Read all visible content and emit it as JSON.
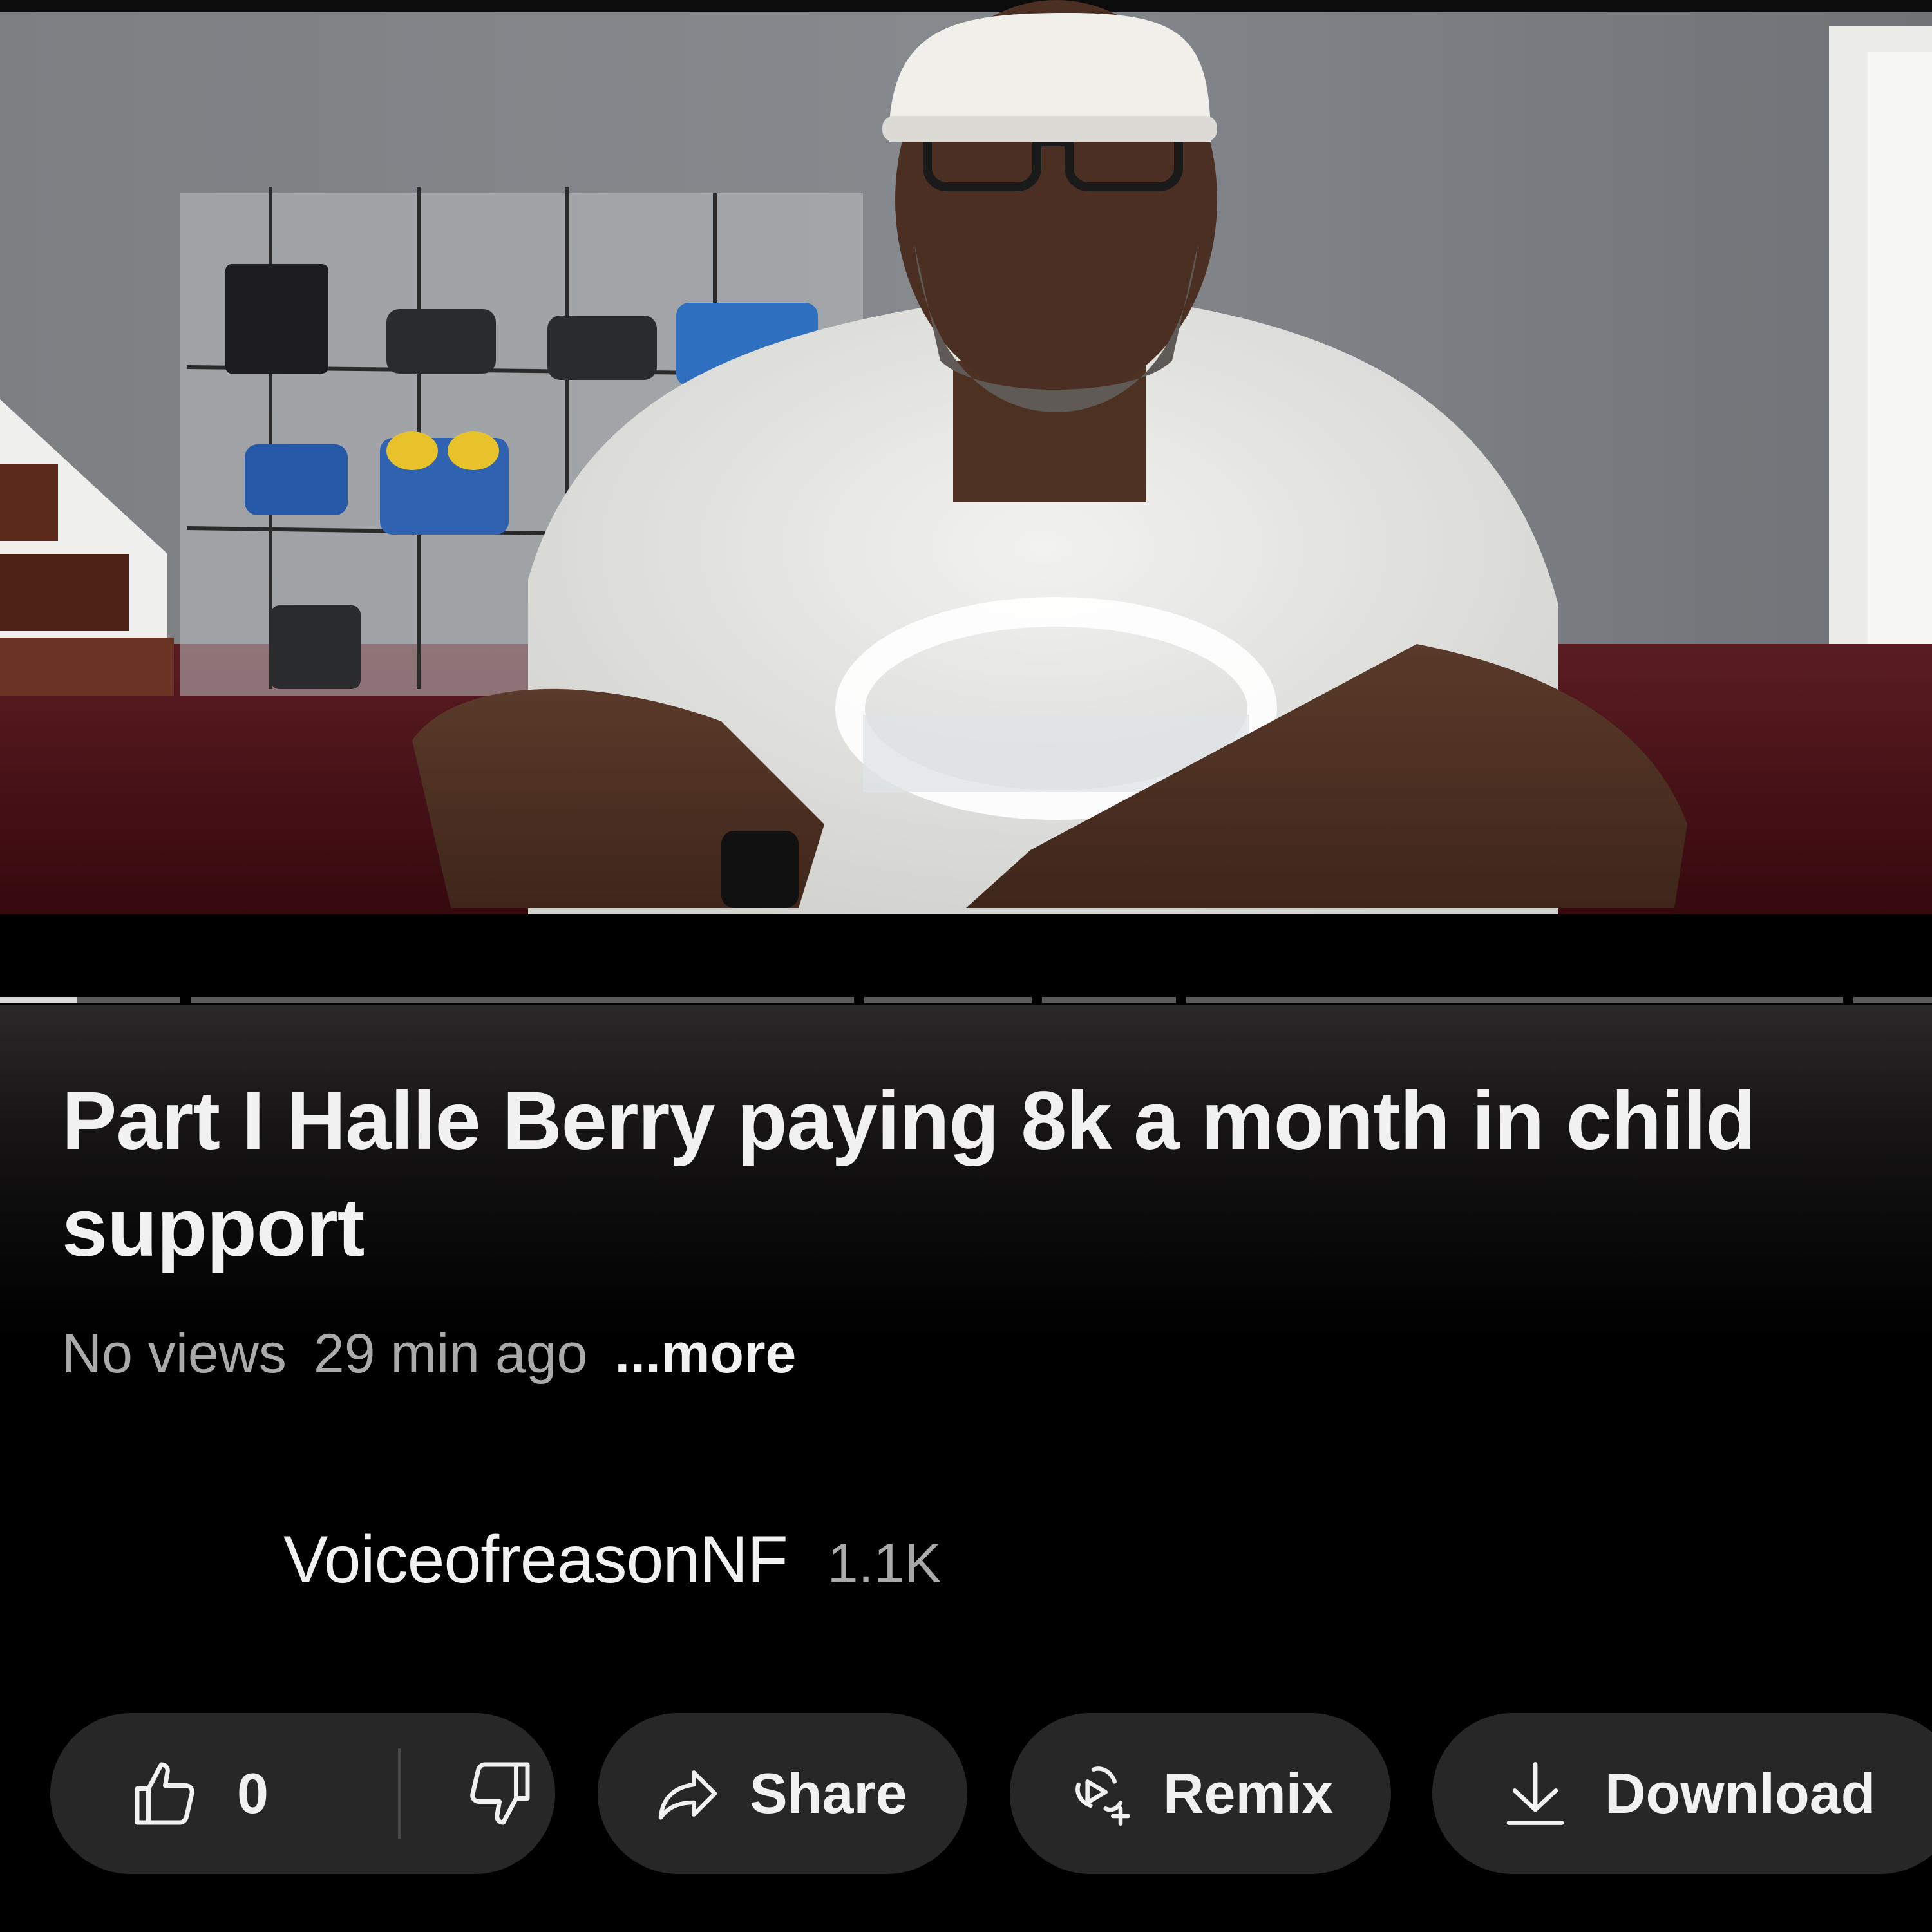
{
  "video": {
    "progress_played_fraction": 0.04
  },
  "title": "Part I Halle Berry paying 8k a month in child support",
  "meta": {
    "views": "No views",
    "time_ago": "29 min ago",
    "more_label": "...more"
  },
  "channel": {
    "name": "VoiceofreasonNF",
    "subscribers": "1.1K"
  },
  "actions": {
    "like_count": "0",
    "share_label": "Share",
    "remix_label": "Remix",
    "download_label": "Download"
  },
  "icons": {
    "like": "thumbs-up-icon",
    "dislike": "thumbs-down-icon",
    "share": "share-arrow-icon",
    "remix": "remix-icon",
    "download": "download-icon"
  },
  "colors": {
    "background": "#000000",
    "pill": "#272727",
    "primary_text": "#f1f1f1",
    "secondary_text": "#aaaaaa"
  }
}
